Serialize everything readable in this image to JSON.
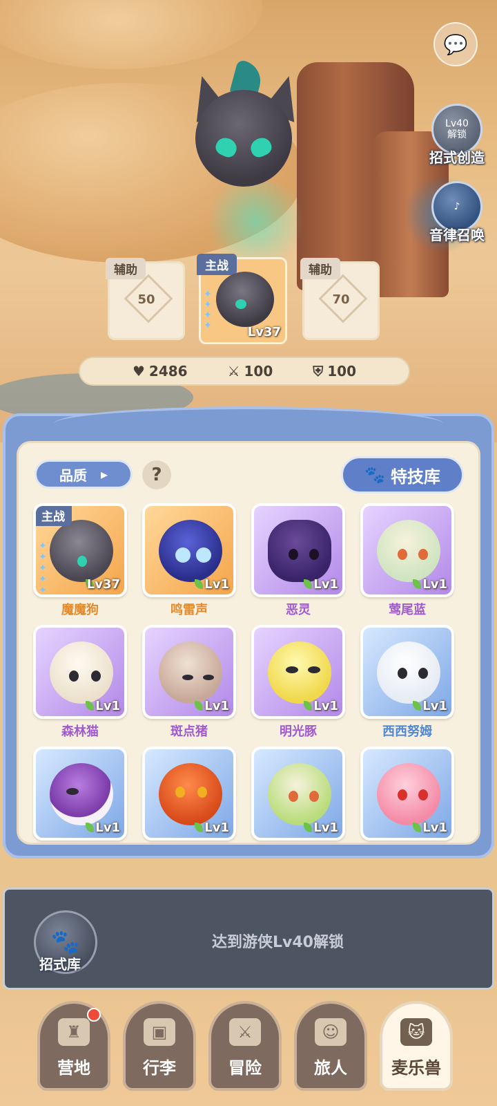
{
  "side_buttons": {
    "move_create": {
      "lock_level": "Lv40",
      "lock_text": "解锁",
      "label": "招式创造"
    },
    "melody_summon": {
      "label": "音律召唤"
    }
  },
  "team": {
    "left": {
      "tag": "辅助",
      "value": "50"
    },
    "main": {
      "tag": "主战",
      "level": "Lv37"
    },
    "right": {
      "tag": "辅助",
      "value": "70"
    }
  },
  "stats": {
    "hp": "2486",
    "attack": "100",
    "defense": "100"
  },
  "filters": {
    "quality_label": "品质",
    "help_label": "?",
    "skill_library_label": "特技库"
  },
  "monsters": [
    {
      "name": "魔魔狗",
      "level": "Lv37",
      "tag": "主战",
      "rarity": "orange"
    },
    {
      "name": "鸣雷声",
      "level": "Lv1",
      "rarity": "orange"
    },
    {
      "name": "恶灵",
      "level": "Lv1",
      "rarity": "purple"
    },
    {
      "name": "莺尾蓝",
      "level": "Lv1",
      "rarity": "purple"
    },
    {
      "name": "森林猫",
      "level": "Lv1",
      "rarity": "purple"
    },
    {
      "name": "斑点猪",
      "level": "Lv1",
      "rarity": "purple"
    },
    {
      "name": "明光豚",
      "level": "Lv1",
      "rarity": "purple"
    },
    {
      "name": "西西努姆",
      "level": "Lv1",
      "rarity": "blue"
    },
    {
      "name": "",
      "level": "Lv1",
      "rarity": "blue"
    },
    {
      "name": "",
      "level": "Lv1",
      "rarity": "blue"
    },
    {
      "name": "",
      "level": "Lv1",
      "rarity": "blue"
    },
    {
      "name": "",
      "level": "Lv1",
      "rarity": "blue"
    }
  ],
  "lockbar": {
    "label": "招式库",
    "message": "达到游侠Lv40解锁"
  },
  "nav": [
    {
      "label": "营地",
      "icon": "castle-icon",
      "badge": true
    },
    {
      "label": "行李",
      "icon": "backpack-icon"
    },
    {
      "label": "冒险",
      "icon": "crossed-swords-icon"
    },
    {
      "label": "旅人",
      "icon": "traveler-icon"
    },
    {
      "label": "麦乐兽",
      "icon": "cat-face-icon",
      "active": true
    }
  ],
  "colors": {
    "panel_blue": "#7d9bd3",
    "rarity_orange": "#f5a54a",
    "rarity_purple": "#b289e8",
    "rarity_blue": "#7ea8e6"
  }
}
